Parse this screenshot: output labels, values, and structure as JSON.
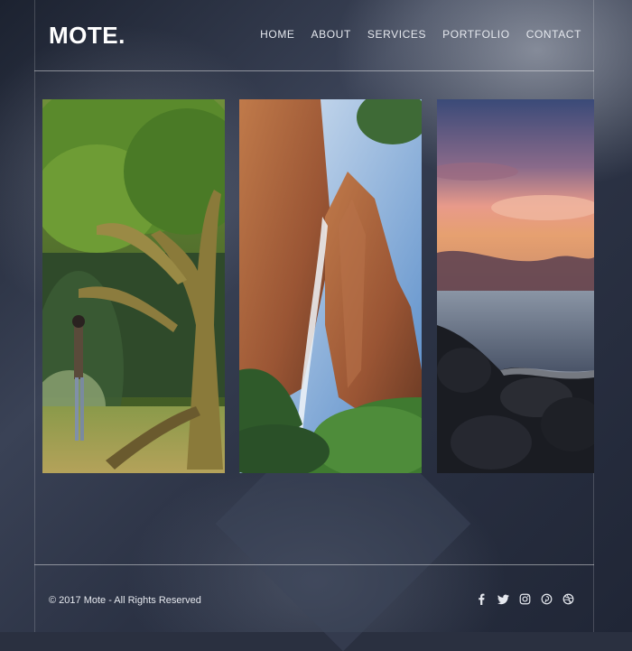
{
  "brand": {
    "logo": "MOTE."
  },
  "nav": {
    "items": [
      {
        "label": "HOME"
      },
      {
        "label": "ABOUT"
      },
      {
        "label": "SERVICES"
      },
      {
        "label": "PORTFOLIO"
      },
      {
        "label": "CONTACT"
      }
    ]
  },
  "gallery": {
    "photos": [
      {
        "subject": "tree-forest-photo"
      },
      {
        "subject": "waterfall-canyon-photo"
      },
      {
        "subject": "sunset-seashore-photo"
      }
    ]
  },
  "footer": {
    "copyright": "© 2017 Mote - All Rights Reserved",
    "socials": [
      "facebook-icon",
      "twitter-icon",
      "instagram-icon",
      "pinterest-icon",
      "dribbble-icon"
    ]
  },
  "colors": {
    "text": "#e6e9ef",
    "background": "#2a3040"
  }
}
